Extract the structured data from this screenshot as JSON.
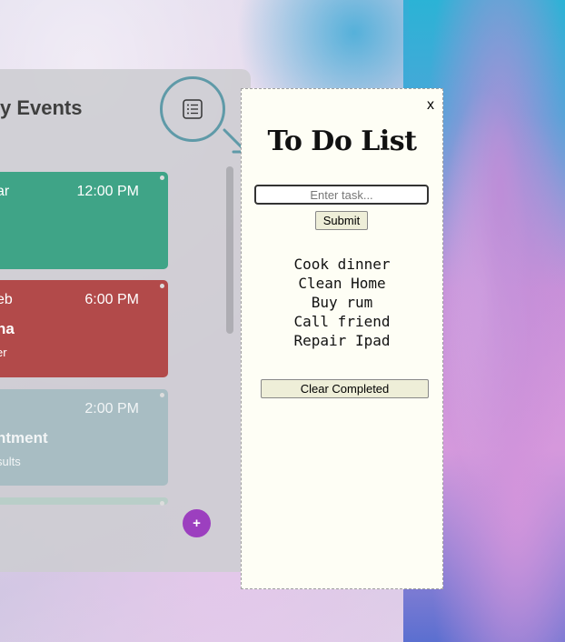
{
  "events": {
    "title": "y Events",
    "cards": [
      {
        "who": "ar",
        "time": "12:00 PM",
        "name": "",
        "sub": ""
      },
      {
        "who": "eb",
        "time": "6:00 PM",
        "name": "na",
        "sub": "er"
      },
      {
        "who": "",
        "time": "2:00 PM",
        "name": "ntment",
        "sub": "sults"
      }
    ],
    "add_label": "+"
  },
  "todo": {
    "close_label": "x",
    "title": "To Do List",
    "input_placeholder": "Enter task...",
    "submit_label": "Submit",
    "items": [
      "Cook dinner",
      "Clean Home",
      "Buy rum",
      "Call friend",
      "Repair Ipad"
    ],
    "clear_label": "Clear Completed"
  },
  "colors": {
    "card_green": "#3fa487",
    "card_red": "#b24a4a",
    "card_gray": "#a8bdc3",
    "accent_purple": "#9c3fbf",
    "ring_teal": "#5f9aa8"
  },
  "icons": {
    "toggle": "list-icon",
    "pointer": "arrow-down-right-icon"
  }
}
